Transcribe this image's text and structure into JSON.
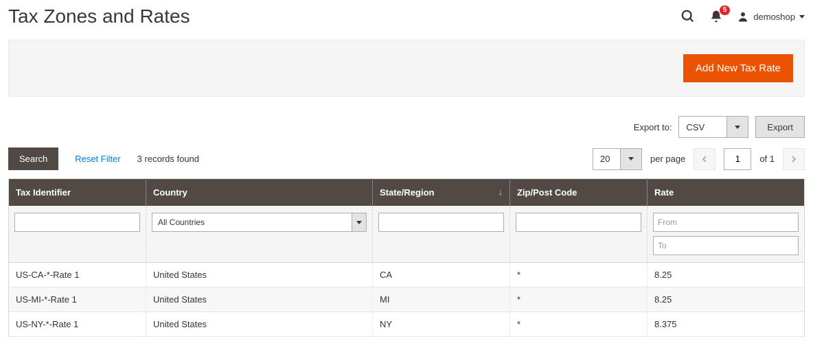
{
  "header": {
    "title": "Tax Zones and Rates",
    "notifications_count": "5",
    "username": "demoshop"
  },
  "actions": {
    "add_label": "Add New Tax Rate"
  },
  "export": {
    "label": "Export to:",
    "selected": "CSV",
    "button": "Export"
  },
  "toolbar": {
    "search_label": "Search",
    "reset_label": "Reset Filter",
    "records_found": "3 records found",
    "per_page_value": "20",
    "per_page_label": "per page",
    "current_page": "1",
    "of_label": "of 1"
  },
  "columns": {
    "tax_identifier": "Tax Identifier",
    "country": "Country",
    "state": "State/Region",
    "zip": "Zip/Post Code",
    "rate": "Rate"
  },
  "filters": {
    "country_selected": "All Countries",
    "rate_from_ph": "From",
    "rate_to_ph": "To"
  },
  "rows": [
    {
      "id": "US-CA-*-Rate 1",
      "country": "United States",
      "state": "CA",
      "zip": "*",
      "rate": "8.25"
    },
    {
      "id": "US-MI-*-Rate 1",
      "country": "United States",
      "state": "MI",
      "zip": "*",
      "rate": "8.25"
    },
    {
      "id": "US-NY-*-Rate 1",
      "country": "United States",
      "state": "NY",
      "zip": "*",
      "rate": "8.375"
    }
  ]
}
